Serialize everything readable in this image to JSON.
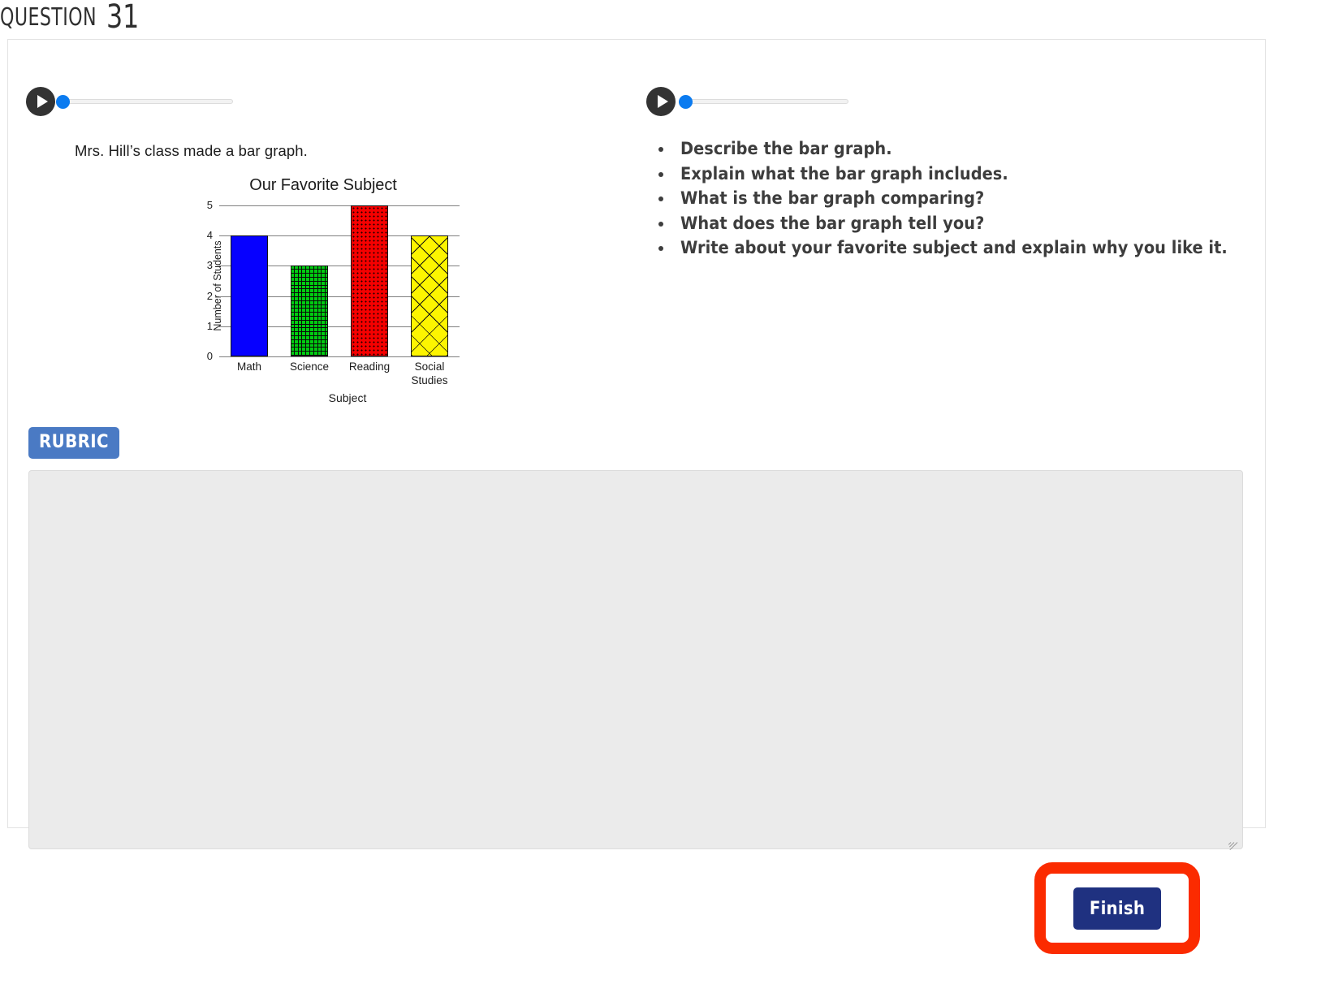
{
  "header": {
    "question_word": "QUESTION",
    "question_number": "31"
  },
  "audio_players": [
    {
      "name": "passage-audio",
      "icon": "play-icon",
      "progress_percent": 0
    },
    {
      "name": "questions-audio",
      "icon": "play-icon",
      "progress_percent": 0
    }
  ],
  "left_panel": {
    "prompt": "Mrs. Hill’s class made a bar graph."
  },
  "chart_data": {
    "type": "bar",
    "title": "Our Favorite Subject",
    "xlabel": "Subject",
    "ylabel": "Number of Students",
    "categories": [
      "Math",
      "Science",
      "Reading",
      "Social Studies"
    ],
    "values": [
      4,
      3,
      5,
      4
    ],
    "ylim": [
      0,
      5
    ],
    "yticks": [
      "0",
      "1",
      "2",
      "3",
      "4",
      "5"
    ],
    "grid": true,
    "legend": "none",
    "bar_styles": [
      {
        "category": "Math",
        "color": "#0600ff",
        "fill": "solid"
      },
      {
        "category": "Science",
        "color": "#00cc11",
        "fill": "basketweave"
      },
      {
        "category": "Reading",
        "color": "#f50000",
        "fill": "dotted"
      },
      {
        "category": "Social Studies",
        "color": "#fdf500",
        "fill": "crosshatch"
      }
    ]
  },
  "right_panel": {
    "bullets": [
      "Describe the bar graph.",
      "Explain what the bar graph includes.",
      "What is the bar graph comparing?",
      "What does the bar graph tell you?",
      "Write about your favorite subject and explain why you like it."
    ]
  },
  "rubric_button": {
    "label": "RUBRIC",
    "color": "#4a7ac4"
  },
  "answer_input": {
    "value": "",
    "placeholder": ""
  },
  "footer": {
    "finish_label": "Finish",
    "finish_color": "#1f3180",
    "highlight_color": "#fb2b00"
  }
}
